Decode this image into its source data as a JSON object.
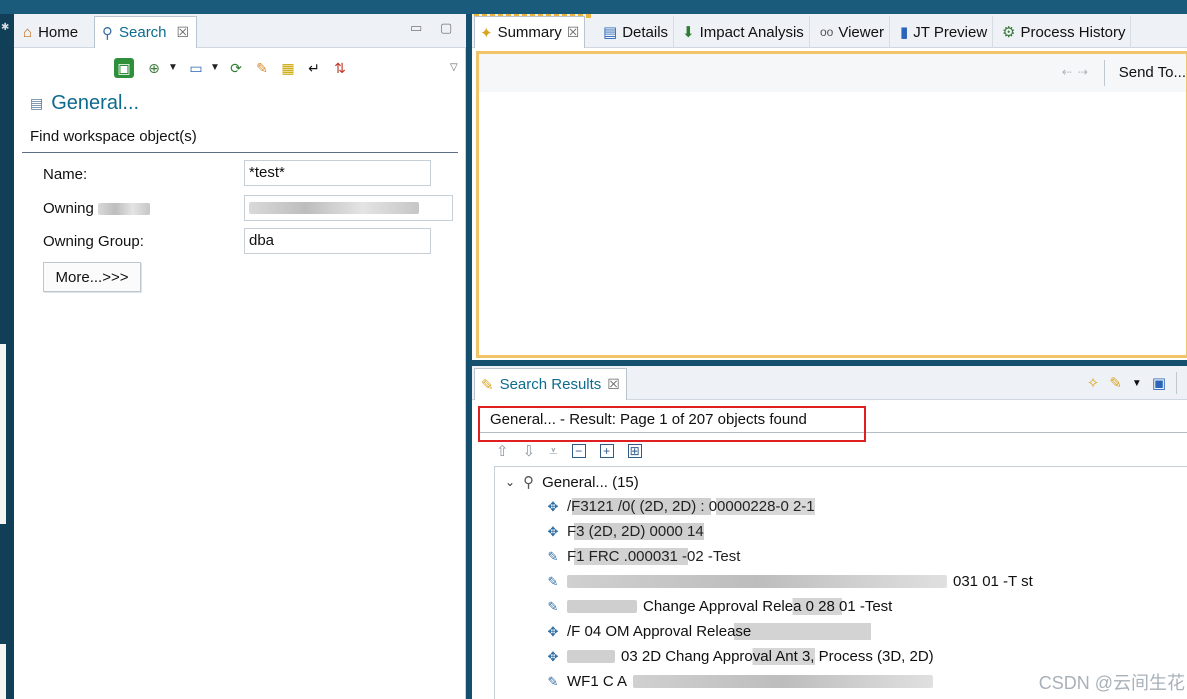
{
  "left_panel": {
    "tabs": [
      {
        "label": "Home",
        "icon": "home-icon"
      },
      {
        "label": "Search",
        "icon": "search-icon",
        "close": "☒"
      }
    ],
    "window_controls": {
      "minimize": "▭",
      "maximize": "▢"
    },
    "general_title": "General...",
    "find_label": "Find workspace object(s)",
    "fields": [
      {
        "label": "Name:",
        "value": "*test*"
      },
      {
        "label": "Owning ",
        "value": ""
      },
      {
        "label": "Owning Group:",
        "value": "dba"
      }
    ],
    "more_button": "More...>>>"
  },
  "right_tabs": [
    {
      "label": "Summary",
      "close": "☒",
      "icon": "summary-icon"
    },
    {
      "label": "Details",
      "icon": "details-icon"
    },
    {
      "label": "Impact Analysis",
      "icon": "impact-analysis-icon"
    },
    {
      "label": "Viewer",
      "icon": "viewer-icon"
    },
    {
      "label": "JT Preview",
      "icon": "jt-preview-icon"
    },
    {
      "label": "Process History",
      "icon": "process-history-icon"
    }
  ],
  "summary": {
    "send_to": "Send To..."
  },
  "search_results": {
    "tab_label": "Search Results",
    "close": "☒",
    "result_text": "General... - Result: Page 1 of 207 objects found",
    "tree_root": "General... (15)",
    "rows": [
      {
        "visible_text": "/F3121 /0(   (2D, 2D) : 00000228-0 2-1"
      },
      {
        "visible_text": "F3   (2D, 2D)   0000 14"
      },
      {
        "visible_text": "F1   FRC   .000031 -02 -Test"
      },
      {
        "visible_text": "031 01 -T st"
      },
      {
        "visible_text": "Change Approval Relea   0 28 01 -Test"
      },
      {
        "visible_text": "/F 04 OM Approval Release"
      },
      {
        "visible_text": "03 2D Chang Approval Ant 3, Process (3D, 2D)"
      },
      {
        "visible_text": "WF1 C A"
      }
    ],
    "watermark": "CSDN @云间生花"
  }
}
